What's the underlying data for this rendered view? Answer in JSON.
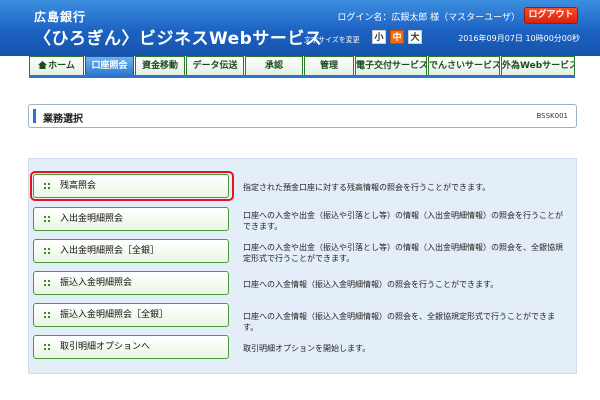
{
  "header": {
    "bank_small": "広島銀行",
    "bank_main": "〈ひろぎん〉ビジネスWebサービス",
    "login_info": "ログイン名：広銀太郎 様（マスターユーザ）",
    "logout_label": "ログアウト",
    "font_size_label": "文字サイズを変更",
    "font_sizes": [
      "小",
      "中",
      "大"
    ],
    "datetime": "2016年09月07日 10時00分00秒"
  },
  "nav": {
    "tabs": [
      {
        "label": "ホーム"
      },
      {
        "label": "口座照会"
      },
      {
        "label": "資金移動"
      },
      {
        "label": "データ伝送"
      },
      {
        "label": "承認"
      },
      {
        "label": "管理"
      },
      {
        "label": "電子交付サービス"
      },
      {
        "label": "でんさいサービス"
      },
      {
        "label": "外為Webサービス"
      }
    ]
  },
  "page": {
    "title": "業務選択",
    "screen_id": "BSSK001"
  },
  "menu": {
    "items": [
      {
        "label": "残高照会",
        "desc": "指定された預金口座に対する残高情報の照会を行うことができます。"
      },
      {
        "label": "入出金明細照会",
        "desc": "口座への入金や出金（振込や引落とし等）の情報（入出金明細情報）の照会を行うことができます。"
      },
      {
        "label": "入出金明細照会［全銀］",
        "desc": "口座への入金や出金（振込や引落とし等）の情報（入出金明細情報）の照会を、全銀協規定形式で行うことができます。"
      },
      {
        "label": "振込入金明細照会",
        "desc": "口座への入金情報（振込入金明細情報）の照会を行うことができます。"
      },
      {
        "label": "振込入金明細照会［全銀］",
        "desc": "口座への入金情報（振込入金明細情報）の照会を、全銀協規定形式で行うことができます。"
      },
      {
        "label": "取引明細オプションへ",
        "desc": "取引明細オプションを開始します。"
      }
    ]
  },
  "colors": {
    "header_blue": "#1c62c2",
    "button_green": "#4a9a3c",
    "highlight_red": "#e8141c",
    "logout_red": "#d8220d"
  }
}
